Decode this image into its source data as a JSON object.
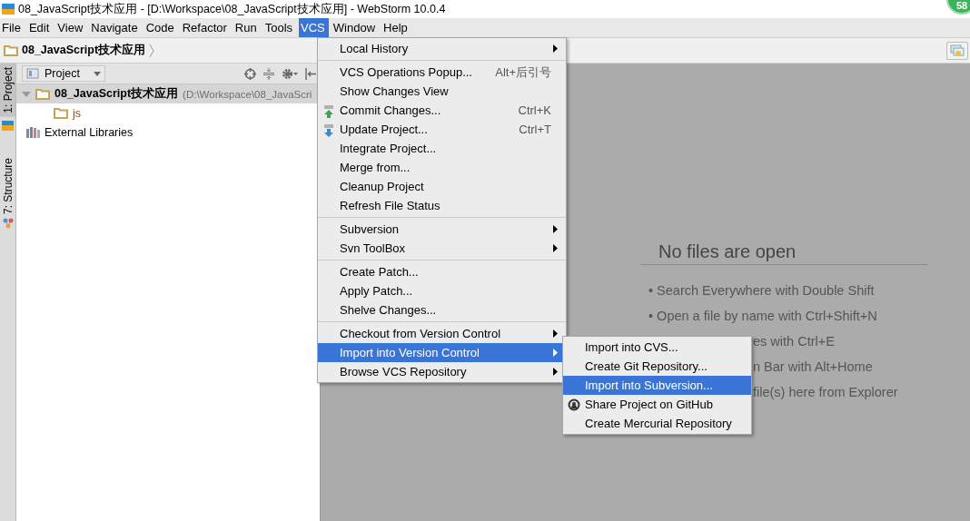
{
  "window": {
    "title": "08_JavaScript技术应用 - [D:\\Workspace\\08_JavaScript技术应用] - WebStorm 10.0.4",
    "badge": "58"
  },
  "menu_bar": [
    {
      "label": "File",
      "selected": false
    },
    {
      "label": "Edit",
      "selected": false
    },
    {
      "label": "View",
      "selected": false
    },
    {
      "label": "Navigate",
      "selected": false
    },
    {
      "label": "Code",
      "selected": false
    },
    {
      "label": "Refactor",
      "selected": false
    },
    {
      "label": "Run",
      "selected": false
    },
    {
      "label": "Tools",
      "selected": false
    },
    {
      "label": "VCS",
      "selected": true
    },
    {
      "label": "Window",
      "selected": false
    },
    {
      "label": "Help",
      "selected": false
    }
  ],
  "breadcrumb": {
    "label": "08_JavaScript技术应用"
  },
  "tool_tabs": [
    {
      "label": "1: Project",
      "kind": "project"
    },
    {
      "label": "7: Structure",
      "kind": "structure"
    }
  ],
  "project_panel": {
    "view": "Project",
    "tree": [
      {
        "label": "08_JavaScript技术应用",
        "path": "(D:\\Workspace\\08_JavaScri",
        "kind": "folder",
        "expanded": true,
        "selected": true,
        "children": [
          {
            "label": "js",
            "kind": "folder",
            "selected": false
          }
        ]
      },
      {
        "label": "External Libraries",
        "kind": "library",
        "selected": false
      }
    ]
  },
  "editor": {
    "heading": "No files are open",
    "hints": [
      {
        "text": "• Search Everywhere with Double Shift",
        "kind": "full"
      },
      {
        "text": "• Open a file by name with Ctrl+Shift+N",
        "kind": "full"
      },
      {
        "text": "es with Ctrl+E",
        "kind": "partial"
      },
      {
        "text": "n Bar with Alt+Home",
        "kind": "partial"
      },
      {
        "text": "file(s) here from Explorer",
        "kind": "partial"
      }
    ]
  },
  "vcs_menu": [
    [
      {
        "label": "Local History",
        "submenu": true,
        "selected": false,
        "kind": "plain"
      }
    ],
    [
      {
        "label": "VCS Operations Popup...",
        "shortcut": "Alt+后引号",
        "submenu": false,
        "selected": false,
        "kind": "plain"
      },
      {
        "label": "Show Changes View",
        "submenu": false,
        "selected": false,
        "kind": "plain"
      },
      {
        "label": "Commit Changes...",
        "shortcut": "Ctrl+K",
        "submenu": false,
        "selected": false,
        "kind": "commit"
      },
      {
        "label": "Update Project...",
        "shortcut": "Ctrl+T",
        "submenu": false,
        "selected": false,
        "kind": "update"
      },
      {
        "label": "Integrate Project...",
        "submenu": false,
        "selected": false,
        "kind": "plain"
      },
      {
        "label": "Merge from...",
        "submenu": false,
        "selected": false,
        "kind": "plain"
      },
      {
        "label": "Cleanup Project",
        "submenu": false,
        "selected": false,
        "kind": "plain"
      },
      {
        "label": "Refresh File Status",
        "submenu": false,
        "selected": false,
        "kind": "plain"
      }
    ],
    [
      {
        "label": "Subversion",
        "submenu": true,
        "selected": false,
        "kind": "plain"
      },
      {
        "label": "Svn ToolBox",
        "submenu": true,
        "selected": false,
        "kind": "plain"
      }
    ],
    [
      {
        "label": "Create Patch...",
        "submenu": false,
        "selected": false,
        "kind": "plain"
      },
      {
        "label": "Apply Patch...",
        "submenu": false,
        "selected": false,
        "kind": "plain"
      },
      {
        "label": "Shelve Changes...",
        "submenu": false,
        "selected": false,
        "kind": "plain"
      }
    ],
    [
      {
        "label": "Checkout from Version Control",
        "submenu": true,
        "selected": false,
        "kind": "plain"
      },
      {
        "label": "Import into Version Control",
        "submenu": true,
        "selected": true,
        "kind": "plain"
      },
      {
        "label": "Browse VCS Repository",
        "submenu": true,
        "selected": false,
        "kind": "plain"
      }
    ]
  ],
  "import_submenu": [
    [
      {
        "label": "Import into CVS...",
        "submenu": false,
        "selected": false,
        "kind": "plain"
      },
      {
        "label": "Create Git Repository...",
        "submenu": false,
        "selected": false,
        "kind": "plain"
      },
      {
        "label": "Import into Subversion...",
        "submenu": false,
        "selected": true,
        "kind": "plain"
      },
      {
        "label": "Share Project on GitHub",
        "submenu": false,
        "selected": false,
        "kind": "github"
      },
      {
        "label": "Create Mercurial Repository",
        "submenu": false,
        "selected": false,
        "kind": "plain"
      }
    ]
  ]
}
